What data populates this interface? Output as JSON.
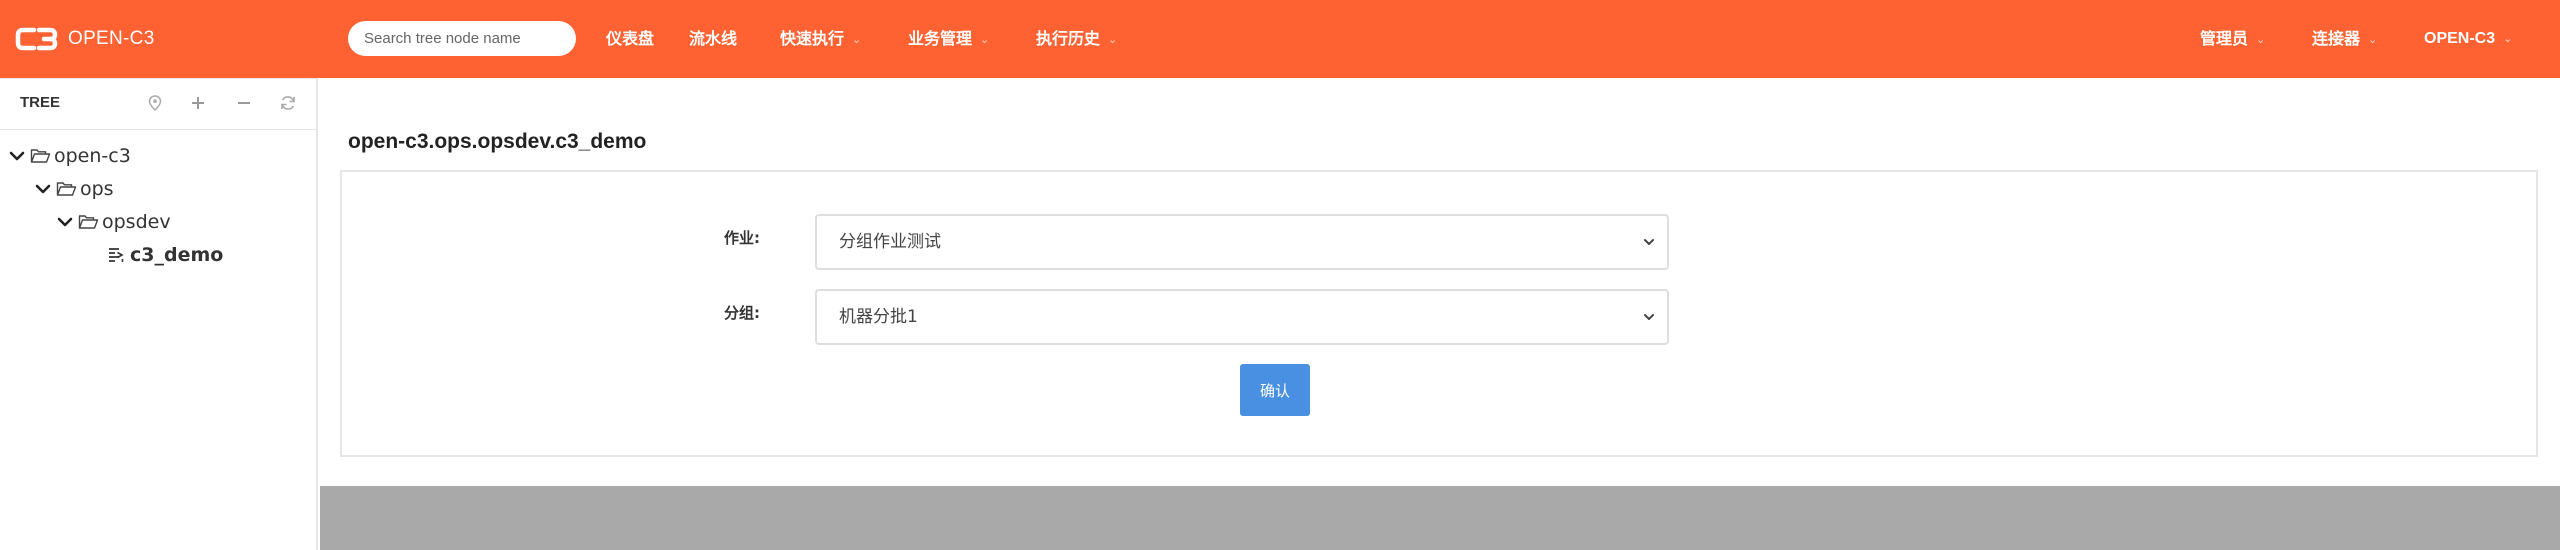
{
  "app": {
    "logo_text": "OPEN-C3",
    "brand_color": "#fe6232",
    "accent_color": "#4a90e2"
  },
  "search": {
    "placeholder": "Search tree node name",
    "value": ""
  },
  "nav": {
    "left": [
      {
        "label": "仪表盘",
        "dropdown": false
      },
      {
        "label": "流水线",
        "dropdown": false
      },
      {
        "label": "快速执行",
        "dropdown": true
      },
      {
        "label": "业务管理",
        "dropdown": true
      },
      {
        "label": "执行历史",
        "dropdown": true
      }
    ],
    "right": [
      {
        "label": "管理员",
        "dropdown": true
      },
      {
        "label": "连接器",
        "dropdown": true
      },
      {
        "label": "OPEN-C3",
        "dropdown": true
      }
    ]
  },
  "tree": {
    "title": "TREE",
    "tools": [
      "locate-icon",
      "plus-icon",
      "minus-icon",
      "refresh-icon"
    ],
    "nodes": [
      {
        "label": "open-c3",
        "type": "folder",
        "expanded": true,
        "depth": 0
      },
      {
        "label": "ops",
        "type": "folder",
        "expanded": true,
        "depth": 1
      },
      {
        "label": "opsdev",
        "type": "folder",
        "expanded": true,
        "depth": 2
      },
      {
        "label": "c3_demo",
        "type": "leaf",
        "selected": true,
        "depth": 3
      }
    ]
  },
  "main": {
    "title": "open-c3.ops.opsdev.c3_demo",
    "form": {
      "job_label": "作业:",
      "job_value": "分组作业测试",
      "group_label": "分组:",
      "group_value": "机器分批1",
      "confirm_label": "确认"
    }
  }
}
